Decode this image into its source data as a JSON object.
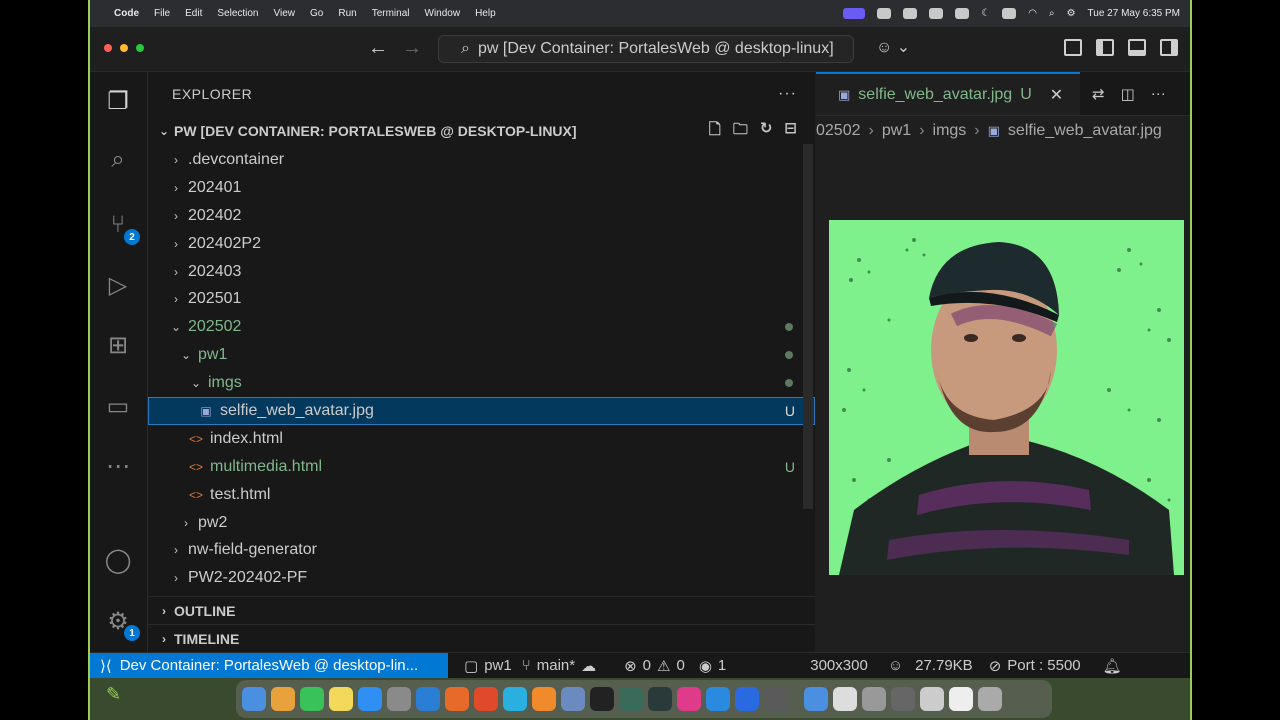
{
  "menubar": {
    "items": [
      "Code",
      "File",
      "Edit",
      "Selection",
      "View",
      "Go",
      "Run",
      "Terminal",
      "Window",
      "Help"
    ],
    "clock": "Tue 27 May  6:35 PM"
  },
  "titlebar": {
    "command_center": "pw [Dev Container: PortalesWeb @ desktop-linux]"
  },
  "activity": {
    "scm_badge": "2",
    "settings_badge": "1"
  },
  "sidebar": {
    "title": "EXPLORER",
    "root": "PW [DEV CONTAINER: PORTALESWEB @ DESKTOP-LINUX]",
    "items": [
      {
        "label": ".devcontainer"
      },
      {
        "label": "202401"
      },
      {
        "label": "202402"
      },
      {
        "label": "202402P2"
      },
      {
        "label": "202403"
      },
      {
        "label": "202501"
      },
      {
        "label": "202502"
      },
      {
        "label": "pw1"
      },
      {
        "label": "imgs"
      },
      {
        "label": "selfie_web_avatar.jpg",
        "status": "U"
      },
      {
        "label": "index.html"
      },
      {
        "label": "multimedia.html",
        "status": "U"
      },
      {
        "label": "test.html"
      },
      {
        "label": "pw2"
      },
      {
        "label": "nw-field-generator"
      },
      {
        "label": "PW2-202402-PF"
      }
    ],
    "outline": "OUTLINE",
    "timeline": "TIMELINE"
  },
  "editor": {
    "tab_label": "selfie_web_avatar.jpg",
    "tab_status": "U",
    "breadcrumb": [
      "02502",
      "pw1",
      "imgs",
      "selfie_web_avatar.jpg"
    ]
  },
  "statusbar": {
    "remote": "Dev Container: PortalesWeb @ desktop-lin...",
    "folder": "pw1",
    "branch": "main*",
    "errors": "0",
    "warnings": "0",
    "ports": "1",
    "dimensions": "300x300",
    "size": "27.79KB",
    "port": "Port : 5500"
  },
  "colors": {
    "accent": "#0078d4",
    "git_untracked": "#81b88b",
    "frame_border": "#9acd5a",
    "image_bg": "#7ef08c"
  }
}
